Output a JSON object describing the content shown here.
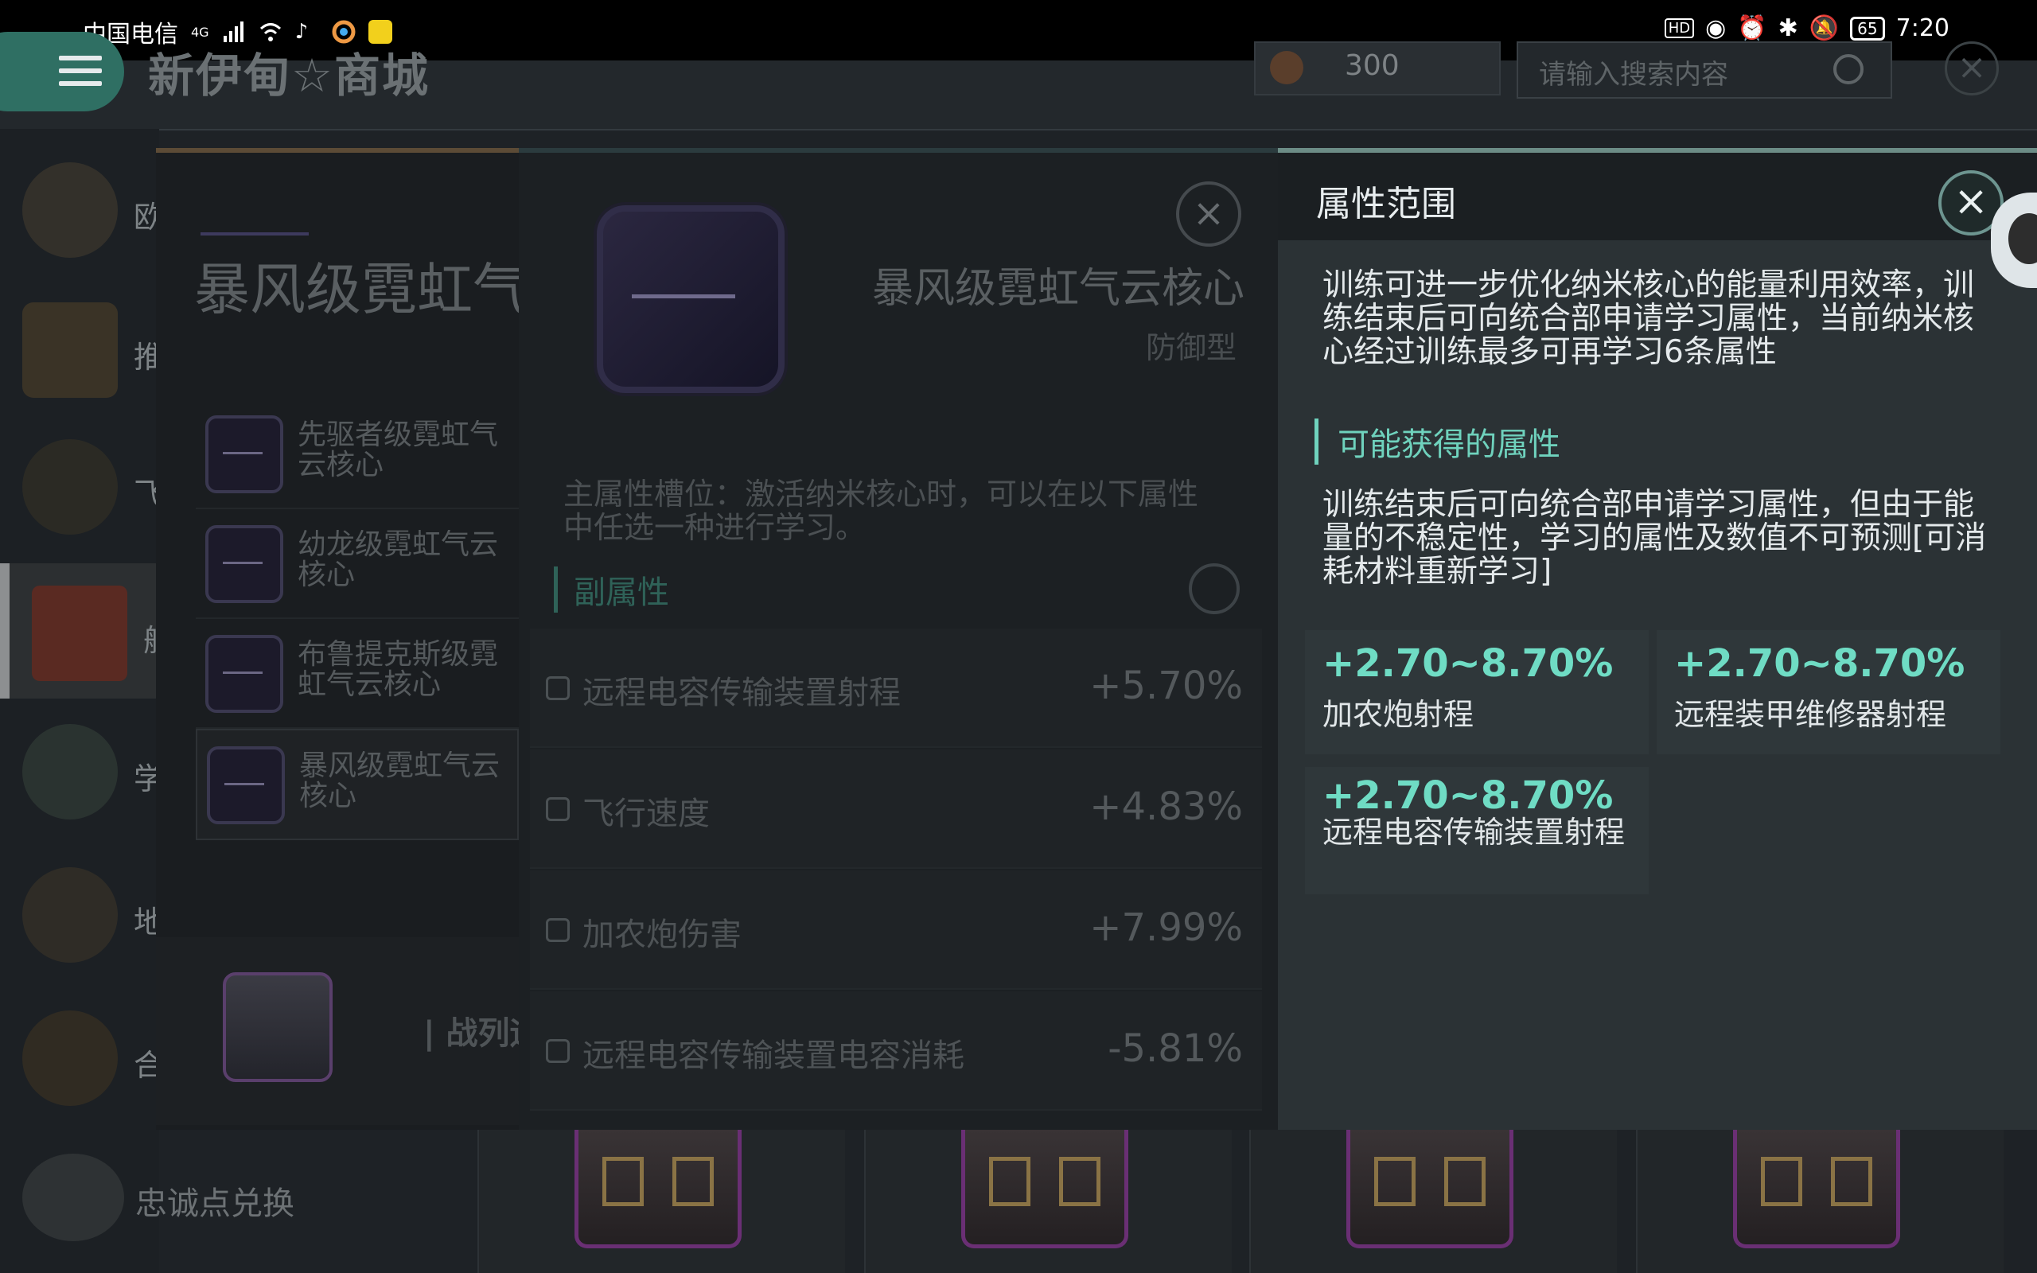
{
  "status": {
    "carrier": "中国电信",
    "network": "4G",
    "time": "7:20",
    "battery": "65"
  },
  "header": {
    "title": "新伊甸☆商城",
    "coins": "300",
    "search_placeholder": "请输入搜索内容"
  },
  "sidebar": {
    "items": [
      {
        "label": "欧",
        "icon": "card-icon"
      },
      {
        "label": "推",
        "icon": "x-emblem-icon"
      },
      {
        "label": "飞",
        "icon": "omega-icon"
      },
      {
        "label": "舰",
        "icon": "ticket-icon"
      },
      {
        "label": "学",
        "icon": "academy-icon"
      },
      {
        "label": "地",
        "icon": "triangle-icon"
      },
      {
        "label": "合",
        "icon": "wings-icon"
      }
    ],
    "loyalty_label": "忠诚点兑换"
  },
  "left_dialog": {
    "title": "暴风级霓虹气",
    "cores": [
      {
        "name": "先驱者级霓虹气云核心"
      },
      {
        "name": "幼龙级霓虹气云核心"
      },
      {
        "name": "布鲁提克斯级霓虹气云核心"
      },
      {
        "name": "暴风级霓虹气云核心"
      }
    ],
    "pack_label": "| 战列运"
  },
  "detail": {
    "name": "暴风级霓虹气云核心",
    "type": "防御型",
    "main_desc": "主属性槽位：激活纳米核心时，可以在以下属性中任选一种进行学习。",
    "sub_title": "副属性",
    "attrs": [
      {
        "name": "远程电容传输装置射程",
        "value": "+5.70%"
      },
      {
        "name": "飞行速度",
        "value": "+4.83%"
      },
      {
        "name": "加农炮伤害",
        "value": "+7.99%"
      },
      {
        "name": "远程电容传输装置电容消耗",
        "value": "-5.81%"
      }
    ]
  },
  "panel": {
    "title": "属性范围",
    "desc": "训练可进一步优化纳米核心的能量利用效率，训练结束后可向统合部申请学习属性，当前纳米核心经过训练最多可再学习6条属性",
    "section_title": "可能获得的属性",
    "section_desc": "训练结束后可向统合部申请学习属性，但由于能量的不稳定性，学习的属性及数值不可预测[可消耗材料重新学习]",
    "ranges": [
      {
        "value": "+2.70~8.70%",
        "name": "加农炮射程"
      },
      {
        "value": "+2.70~8.70%",
        "name": "远程装甲维修器射程"
      },
      {
        "value": "+2.70~8.70%",
        "name": "远程电容传输装置射程"
      }
    ]
  },
  "colors": {
    "accent": "#6fdcc4",
    "panel_bg": "#2b3235",
    "dim_bg": "#1c2023"
  }
}
